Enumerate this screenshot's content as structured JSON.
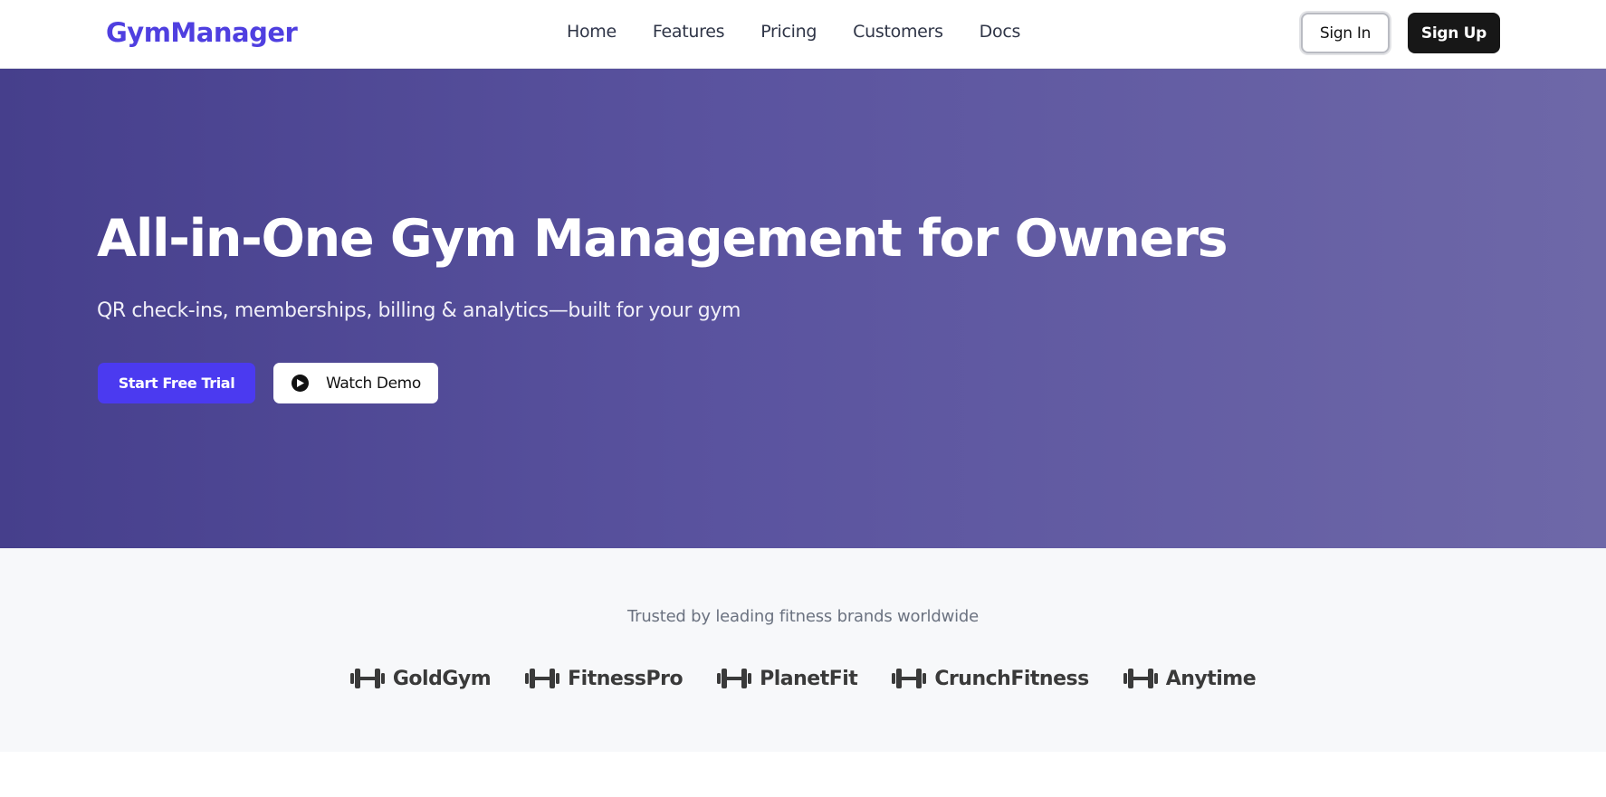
{
  "navbar": {
    "logo": "GymManager",
    "links": [
      "Home",
      "Features",
      "Pricing",
      "Customers",
      "Docs"
    ],
    "sign_in": "Sign In",
    "sign_up": "Sign Up"
  },
  "hero": {
    "title": "All-in-One Gym Management for Owners",
    "subtitle": "QR check-ins, memberships, billing & analytics—built for your gym",
    "primary_cta": "Start Free Trial",
    "secondary_cta": "Watch Demo",
    "secondary_cta_icon": "play-circle-icon"
  },
  "trusted": {
    "heading": "Trusted by leading fitness brands worldwide",
    "brand_icon": "dumbbell-icon",
    "brands": [
      "GoldGym",
      "FitnessPro",
      "PlanetFit",
      "CrunchFitness",
      "Anytime"
    ]
  },
  "colors": {
    "brand": "#4f3fe0",
    "cta": "#4b3af0",
    "hero_gradient_start": "#463f8c",
    "hero_gradient_end": "#6e68a8"
  }
}
